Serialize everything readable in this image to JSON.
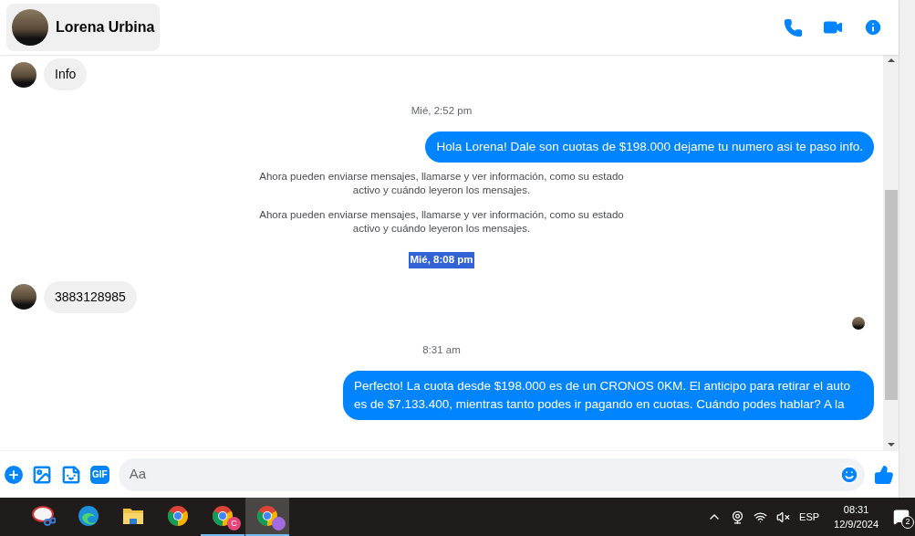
{
  "header": {
    "contact_name": "Lorena Urbina"
  },
  "messages": [
    {
      "kind": "received",
      "text": "Info"
    },
    {
      "kind": "timestamp",
      "text": "Mié, 2:52 pm",
      "highlighted": false
    },
    {
      "kind": "sent",
      "text": "Hola Lorena! Dale son cuotas de $198.000 dejame tu numero asi te paso info."
    },
    {
      "kind": "system",
      "text": "Ahora pueden enviarse mensajes, llamarse y ver información, como su estado activo y cuándo leyeron los mensajes."
    },
    {
      "kind": "system",
      "text": "Ahora pueden enviarse mensajes, llamarse y ver información, como su estado activo y cuándo leyeron los mensajes."
    },
    {
      "kind": "timestamp",
      "text": "Mié, 8:08 pm",
      "highlighted": true
    },
    {
      "kind": "received",
      "text": "3883128985"
    },
    {
      "kind": "seen"
    },
    {
      "kind": "timestamp",
      "text": "8:31 am",
      "highlighted": false
    },
    {
      "kind": "sent",
      "text": "Perfecto! La cuota desde $198.000 es de un CRONOS 0KM. El anticipo para retirar el auto es de $7.133.400, mientras tanto podes ir pagando en cuotas. Cuándo podes hablar? A la"
    }
  ],
  "composer": {
    "gif_label": "GIF",
    "placeholder": "Aa"
  },
  "taskbar": {
    "apps": [
      {
        "kind": "snip",
        "running": false,
        "selected": false
      },
      {
        "kind": "edge",
        "running": false,
        "selected": false
      },
      {
        "kind": "folder",
        "running": false,
        "selected": false
      },
      {
        "kind": "chrome",
        "running": false,
        "selected": false
      },
      {
        "kind": "chrome",
        "running": true,
        "selected": false,
        "badge": "C"
      },
      {
        "kind": "chrome",
        "running": true,
        "selected": true,
        "badge_photo": true
      }
    ],
    "language": "ESP",
    "time": "08:31",
    "date": "12/9/2024",
    "notifications": "2"
  }
}
